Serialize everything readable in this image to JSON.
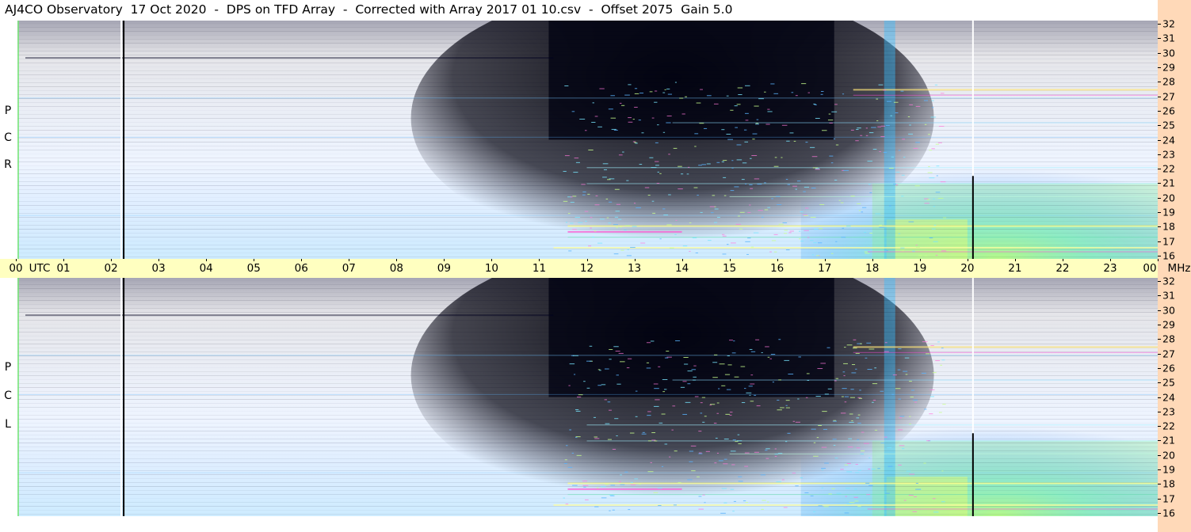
{
  "title": "AJ4CO Observatory  17 Oct 2020  -  DPS on TFD Array  -  Corrected with Array 2017 01 10.csv  -  Offset 2075  Gain 5.0",
  "chart_data": [
    {
      "type": "heatmap",
      "name": "RCP",
      "panel_label": [
        "R",
        "C",
        "P"
      ],
      "x_unit": "UTC",
      "y_unit": "MHz",
      "ylim": [
        16,
        32
      ]
    },
    {
      "type": "heatmap",
      "name": "LCP",
      "panel_label": [
        "L",
        "C",
        "P"
      ],
      "x_unit": "UTC",
      "y_unit": "MHz",
      "ylim": [
        16,
        32
      ]
    }
  ],
  "time_axis": {
    "ticks": [
      "00",
      "01",
      "02",
      "03",
      "04",
      "05",
      "06",
      "07",
      "08",
      "09",
      "10",
      "11",
      "12",
      "13",
      "14",
      "15",
      "16",
      "17",
      "18",
      "19",
      "20",
      "21",
      "22",
      "23",
      "00"
    ],
    "utc_label": "UTC",
    "mhz_label": "MHz"
  },
  "freq_ticks": [
    "32",
    "31",
    "30",
    "29",
    "28",
    "27",
    "26",
    "25",
    "24",
    "23",
    "22",
    "21",
    "20",
    "19",
    "18",
    "17",
    "16"
  ],
  "colors": {
    "background_frame": "#ffffff",
    "time_axis_bg": "#ffffc0",
    "right_strip_bg": "#ffd9b8",
    "deep_blue": "#0a2a9a",
    "mid_blue": "#1650e0",
    "dark_night": "#02051a",
    "cyan": "#22c8f0",
    "green_yellow": "#b8f060",
    "magenta_rfi": "#ff40d0"
  }
}
